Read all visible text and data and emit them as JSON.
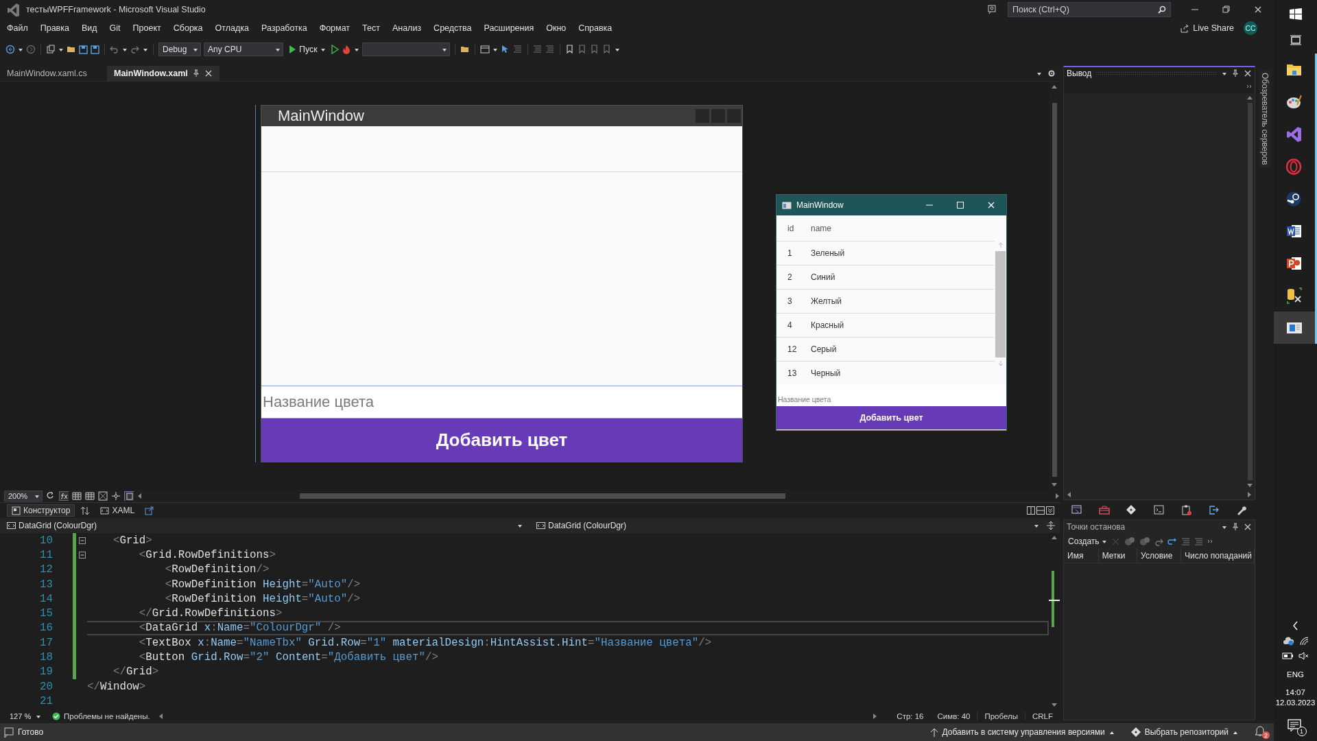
{
  "window": {
    "title": "тестыWPFFramework - Microsoft Visual Studio"
  },
  "search": {
    "placeholder": "Поиск (Ctrl+Q)"
  },
  "account": {
    "live_share": "Live Share",
    "initials": "CC"
  },
  "menu": [
    "Файл",
    "Правка",
    "Вид",
    "Git",
    "Проект",
    "Сборка",
    "Отладка",
    "Разработка",
    "Формат",
    "Тест",
    "Анализ",
    "Средства",
    "Расширения",
    "Окно",
    "Справка"
  ],
  "toolbar": {
    "configuration": "Debug",
    "platform": "Any CPU",
    "start": "Пуск"
  },
  "document_tabs": [
    {
      "label": "MainWindow.xaml.cs",
      "selected": false
    },
    {
      "label": "MainWindow.xaml",
      "selected": true
    }
  ],
  "designer": {
    "zoom": "200%",
    "window_title": "MainWindow",
    "textbox_placeholder": "Название цвета",
    "button": "Добавить цвет"
  },
  "running_window": {
    "title": "MainWindow",
    "columns": [
      "id",
      "name"
    ],
    "rows": [
      [
        "1",
        "Зеленый"
      ],
      [
        "2",
        "Синий"
      ],
      [
        "3",
        "Желтый"
      ],
      [
        "4",
        "Красный"
      ],
      [
        "12",
        "Серый"
      ],
      [
        "13",
        "Черный"
      ]
    ],
    "textbox_placeholder": "Название цвета",
    "button": "Добавить цвет"
  },
  "view_tabs": [
    {
      "label": "Конструктор",
      "selected": true
    },
    {
      "label": "XAML",
      "selected": false
    }
  ],
  "navigation": {
    "left": "DataGrid (ColourDgr)",
    "right": "DataGrid (ColourDgr)"
  },
  "code": {
    "lines": [
      {
        "number": "10",
        "changed": true,
        "current": false,
        "collapsible": true,
        "tokens": [
          {
            "kind": "punct",
            "text": "    <"
          },
          {
            "kind": "tag",
            "text": "Grid"
          },
          {
            "kind": "punct",
            "text": ">"
          }
        ]
      },
      {
        "number": "11",
        "changed": true,
        "current": false,
        "collapsible": true,
        "tokens": [
          {
            "kind": "punct",
            "text": "        <"
          },
          {
            "kind": "tag",
            "text": "Grid.RowDefinitions"
          },
          {
            "kind": "punct",
            "text": ">"
          }
        ]
      },
      {
        "number": "12",
        "changed": true,
        "current": false,
        "collapsible": false,
        "tokens": [
          {
            "kind": "punct",
            "text": "            <"
          },
          {
            "kind": "tag",
            "text": "RowDefinition"
          },
          {
            "kind": "punct",
            "text": "/>"
          }
        ]
      },
      {
        "number": "13",
        "changed": true,
        "current": false,
        "collapsible": false,
        "tokens": [
          {
            "kind": "punct",
            "text": "            <"
          },
          {
            "kind": "tag",
            "text": "RowDefinition"
          },
          {
            "kind": "attr",
            "text": " Height"
          },
          {
            "kind": "punct",
            "text": "="
          },
          {
            "kind": "value",
            "text": "\"Auto\""
          },
          {
            "kind": "punct",
            "text": "/>"
          }
        ]
      },
      {
        "number": "14",
        "changed": true,
        "current": false,
        "collapsible": false,
        "tokens": [
          {
            "kind": "punct",
            "text": "            <"
          },
          {
            "kind": "tag",
            "text": "RowDefinition"
          },
          {
            "kind": "attr",
            "text": " Height"
          },
          {
            "kind": "punct",
            "text": "="
          },
          {
            "kind": "value",
            "text": "\"Auto\""
          },
          {
            "kind": "punct",
            "text": "/>"
          }
        ]
      },
      {
        "number": "15",
        "changed": true,
        "current": false,
        "collapsible": false,
        "tokens": [
          {
            "kind": "punct",
            "text": "        </"
          },
          {
            "kind": "tag",
            "text": "Grid.RowDefinitions"
          },
          {
            "kind": "punct",
            "text": ">"
          }
        ]
      },
      {
        "number": "16",
        "changed": true,
        "current": true,
        "collapsible": false,
        "tokens": [
          {
            "kind": "punct",
            "text": "        <"
          },
          {
            "kind": "tag",
            "text": "DataGrid"
          },
          {
            "kind": "attr",
            "text": " x"
          },
          {
            "kind": "punct",
            "text": ":"
          },
          {
            "kind": "attr",
            "text": "Name"
          },
          {
            "kind": "punct",
            "text": "="
          },
          {
            "kind": "value",
            "text": "\"ColourDgr\""
          },
          {
            "kind": "punct",
            "text": " />"
          }
        ]
      },
      {
        "number": "17",
        "changed": true,
        "current": false,
        "collapsible": false,
        "tokens": [
          {
            "kind": "punct",
            "text": "        <"
          },
          {
            "kind": "tag",
            "text": "TextBox"
          },
          {
            "kind": "attr",
            "text": " x"
          },
          {
            "kind": "punct",
            "text": ":"
          },
          {
            "kind": "attr",
            "text": "Name"
          },
          {
            "kind": "punct",
            "text": "="
          },
          {
            "kind": "value",
            "text": "\"NameTbx\""
          },
          {
            "kind": "attr",
            "text": " Grid.Row"
          },
          {
            "kind": "punct",
            "text": "="
          },
          {
            "kind": "value",
            "text": "\"1\""
          },
          {
            "kind": "attr",
            "text": " materialDesign"
          },
          {
            "kind": "punct",
            "text": ":"
          },
          {
            "kind": "attr",
            "text": "HintAssist.Hint"
          },
          {
            "kind": "punct",
            "text": "="
          },
          {
            "kind": "value",
            "text": "\"Название цвета\""
          },
          {
            "kind": "punct",
            "text": "/>"
          }
        ]
      },
      {
        "number": "18",
        "changed": true,
        "current": false,
        "collapsible": false,
        "tokens": [
          {
            "kind": "punct",
            "text": "        <"
          },
          {
            "kind": "tag",
            "text": "Button"
          },
          {
            "kind": "attr",
            "text": " Grid.Row"
          },
          {
            "kind": "punct",
            "text": "="
          },
          {
            "kind": "value",
            "text": "\"2\""
          },
          {
            "kind": "attr",
            "text": " Content"
          },
          {
            "kind": "punct",
            "text": "="
          },
          {
            "kind": "value",
            "text": "\"Добавить цвет\""
          },
          {
            "kind": "punct",
            "text": "/>"
          }
        ]
      },
      {
        "number": "19",
        "changed": true,
        "current": false,
        "collapsible": false,
        "tokens": [
          {
            "kind": "punct",
            "text": "    </"
          },
          {
            "kind": "tag",
            "text": "Grid"
          },
          {
            "kind": "punct",
            "text": ">"
          }
        ]
      },
      {
        "number": "20",
        "changed": false,
        "current": false,
        "collapsible": false,
        "tokens": [
          {
            "kind": "punct",
            "text": "</"
          },
          {
            "kind": "tag",
            "text": "Window"
          },
          {
            "kind": "punct",
            "text": ">"
          }
        ]
      },
      {
        "number": "21",
        "changed": false,
        "current": false,
        "collapsible": false
      }
    ]
  },
  "editor_status": {
    "zoom": "127 %",
    "issues": "Проблемы не найдены.",
    "line": "Стр: 16",
    "column": "Симв: 40",
    "indent": "Пробелы",
    "line_endings": "CRLF"
  },
  "output_panel": {
    "title": "Вывод"
  },
  "side_tab": "Обозреватель серверов",
  "breakpoints_panel": {
    "title": "Точки останова",
    "create": "Создать",
    "columns": [
      "Имя",
      "Метки",
      "Условие",
      "Число попаданий"
    ]
  },
  "status_bar": {
    "state": "Готово",
    "add_to_source_control": "Добавить в систему управления версиями",
    "select_repository": "Выбрать репозиторий",
    "notifications": "2"
  },
  "taskbar": {
    "apps": [
      {
        "kind": "explorer",
        "selected": false
      },
      {
        "kind": "paint",
        "selected": false
      },
      {
        "kind": "visual_studio",
        "selected": false
      },
      {
        "kind": "opera",
        "selected": false
      },
      {
        "kind": "steam",
        "selected": false
      },
      {
        "kind": "word",
        "selected": false
      },
      {
        "kind": "powerpoint",
        "selected": false
      },
      {
        "kind": "database",
        "selected": false
      },
      {
        "kind": "app",
        "selected": true
      }
    ],
    "language": "ENG",
    "time": "14:07",
    "date": "12.03.2023",
    "notifications": "1"
  }
}
